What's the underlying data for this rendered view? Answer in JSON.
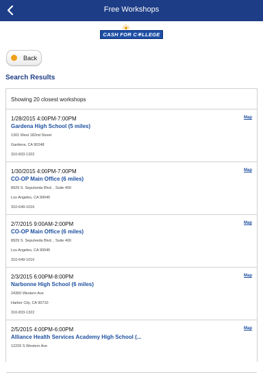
{
  "navbar": {
    "title": "Free Workshops"
  },
  "logo": {
    "text": "CASH FOR C☀LLEGE"
  },
  "back_button": {
    "label": "Back"
  },
  "section_title": "Search Results",
  "showing_text": "Showing 20 closest workshops",
  "map_label": "Map",
  "workshops": [
    {
      "datetime": "1/28/2015 4:00PM-7:00PM",
      "name": "Gardena High School (5 miles)",
      "street": "1301 West 182nd Street",
      "city": "Gardena, CA 90248",
      "phone": "310-833-1322"
    },
    {
      "datetime": "1/30/2015 4:00PM-7:00PM",
      "name": "CO-OP Main Office (6 miles)",
      "street": "8929 S. Sepulveda Blvd. , Suite 400",
      "city": "Los Angeles, CA 90045",
      "phone": "310-649-1016"
    },
    {
      "datetime": "2/7/2015 9:00AM-2:00PM",
      "name": "CO-OP Main Office (6 miles)",
      "street": "8929 S. Sepulveda Blvd. , Suite 400",
      "city": "Los Angeles, CA 90045",
      "phone": "310-649-1016"
    },
    {
      "datetime": "2/3/2015 6:00PM-8:00PM",
      "name": "Narbonne High School (6 miles)",
      "street": "24300 Western Ave",
      "city": "Harbor City, CA 90710",
      "phone": "310-833-1322"
    },
    {
      "datetime": "2/5/2015 4:00PM-6:00PM",
      "name": "Alliance Health Services Academy High School (...",
      "street": "12226 S Western Ave",
      "city": "",
      "phone": ""
    }
  ],
  "colors": {
    "navbar": "#1d3d87",
    "link": "#1d4fa0",
    "accent": "#f0a01a"
  },
  "icons": {
    "back": "chevron-left-icon",
    "logo_star": "sun-icon"
  }
}
